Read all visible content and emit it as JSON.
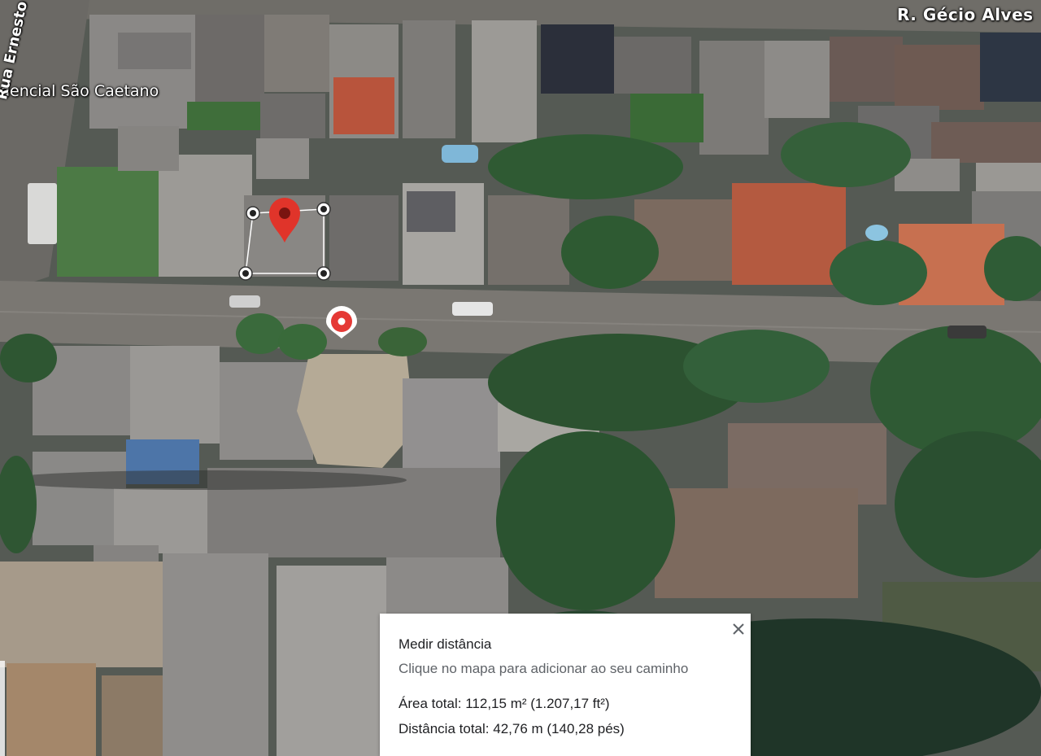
{
  "map": {
    "type": "satellite",
    "labels": {
      "street_top_right": "R. Gécio Alves",
      "condominium": "dencial São Caetano",
      "street_left": "Rua Ernesto Tobbato"
    },
    "marker_color": "#e53935",
    "vertex_color": "#ffffff"
  },
  "measure_panel": {
    "title": "Medir distância",
    "hint": "Clique no mapa para adicionar ao seu caminho",
    "area_label": "Área total:",
    "area_value": "112,15 m² (1.207,17 ft²)",
    "distance_label": "Distância total:",
    "distance_value": "42,76 m (140,28 pés)",
    "close_icon": "close-icon"
  }
}
